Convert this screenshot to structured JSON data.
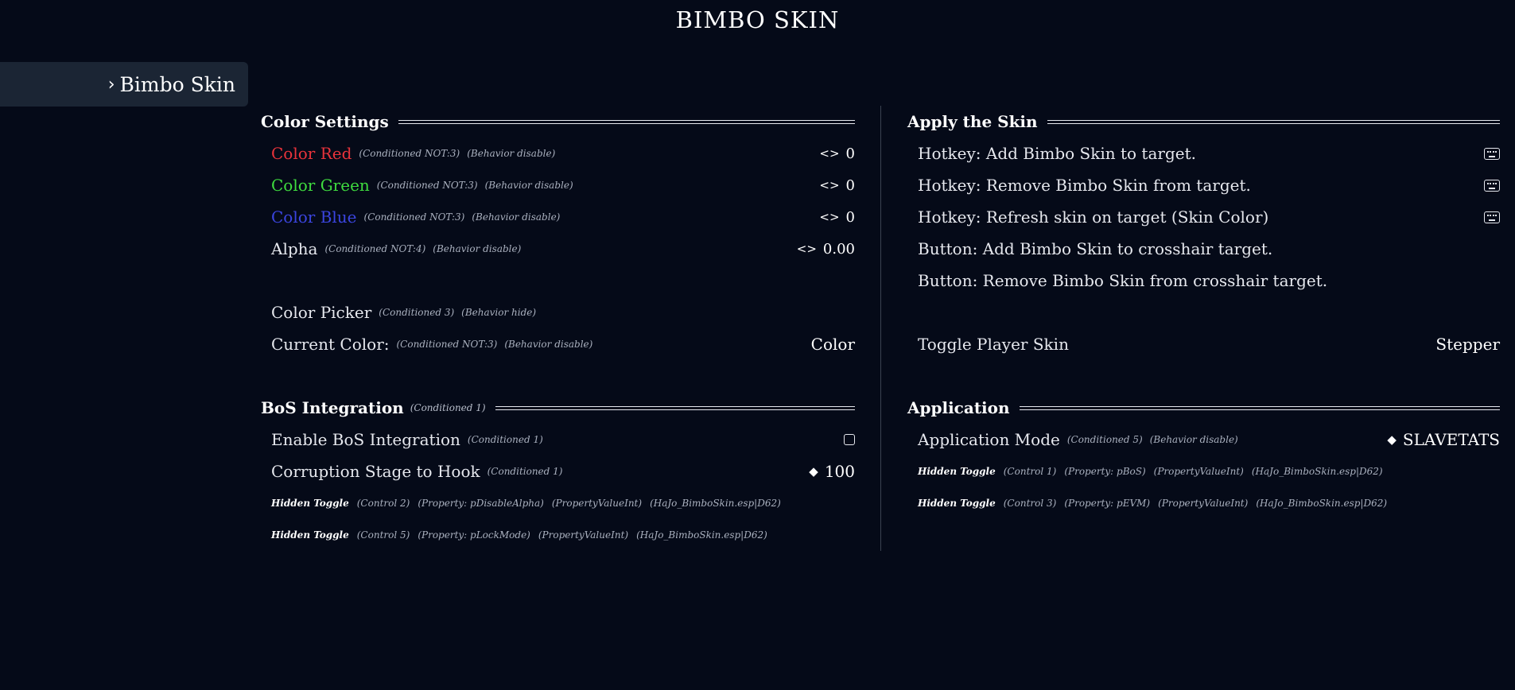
{
  "page_title": "BIMBO SKIN",
  "sidebar": {
    "items": [
      {
        "chevron": "›",
        "label": "Bimbo Skin"
      }
    ]
  },
  "colors": {
    "background": "#050a18",
    "sidebar_active": "#1b2534",
    "red_label": "#e9333b",
    "green_label": "#3fdc3f",
    "blue_label": "#3b45e0"
  },
  "color_settings": {
    "title": "Color Settings",
    "red": {
      "label": "Color Red",
      "note1": "(Conditioned NOT:3)",
      "note2": "(Behavior disable)",
      "glyph": "<>",
      "value": "0"
    },
    "green": {
      "label": "Color Green",
      "note1": "(Conditioned NOT:3)",
      "note2": "(Behavior disable)",
      "glyph": "<>",
      "value": "0"
    },
    "blue": {
      "label": "Color Blue",
      "note1": "(Conditioned NOT:3)",
      "note2": "(Behavior disable)",
      "glyph": "<>",
      "value": "0"
    },
    "alpha": {
      "label": "Alpha",
      "note1": "(Conditioned NOT:4)",
      "note2": "(Behavior disable)",
      "glyph": "<>",
      "value": "0.00"
    },
    "picker": {
      "label": "Color Picker",
      "note1": "(Conditioned 3)",
      "note2": "(Behavior hide)"
    },
    "current": {
      "label": "Current Color:",
      "note1": "(Conditioned NOT:3)",
      "note2": "(Behavior disable)",
      "value": "Color"
    }
  },
  "bos": {
    "title": "BoS Integration",
    "note": "(Conditioned 1)",
    "enable": {
      "label": "Enable BoS Integration",
      "note1": "(Conditioned 1)"
    },
    "corruption": {
      "label": "Corruption Stage to Hook",
      "note1": "(Conditioned 1)",
      "glyph": "◆",
      "value": "100"
    },
    "hidden1": {
      "label": "Hidden Toggle",
      "n1": "(Control 2)",
      "n2": "(Property: pDisableAlpha)",
      "n3": "(PropertyValueInt)",
      "n4": "(HaJo_BimboSkin.esp|D62)"
    },
    "hidden2": {
      "label": "Hidden Toggle",
      "n1": "(Control 5)",
      "n2": "(Property: pLockMode)",
      "n3": "(PropertyValueInt)",
      "n4": "(HaJo_BimboSkin.esp|D62)"
    }
  },
  "apply": {
    "title": "Apply the Skin",
    "hotkey_add": "Hotkey: Add Bimbo Skin to target.",
    "hotkey_remove": "Hotkey: Remove Bimbo Skin from target.",
    "hotkey_refresh": "Hotkey: Refresh skin on target (Skin Color)",
    "button_add": "Button: Add Bimbo Skin to crosshair target.",
    "button_remove": "Button: Remove Bimbo Skin from crosshair target.",
    "toggle_player": {
      "label": "Toggle Player Skin",
      "value": "Stepper"
    }
  },
  "application": {
    "title": "Application",
    "mode": {
      "label": "Application Mode",
      "note1": "(Conditioned 5)",
      "note2": "(Behavior disable)",
      "glyph": "◆",
      "value": "SLAVETATS"
    },
    "hidden1": {
      "label": "Hidden Toggle",
      "n1": "(Control 1)",
      "n2": "(Property: pBoS)",
      "n3": "(PropertyValueInt)",
      "n4": "(HaJo_BimboSkin.esp|D62)"
    },
    "hidden2": {
      "label": "Hidden Toggle",
      "n1": "(Control 3)",
      "n2": "(Property: pEVM)",
      "n3": "(PropertyValueInt)",
      "n4": "(HaJo_BimboSkin.esp|D62)"
    }
  }
}
